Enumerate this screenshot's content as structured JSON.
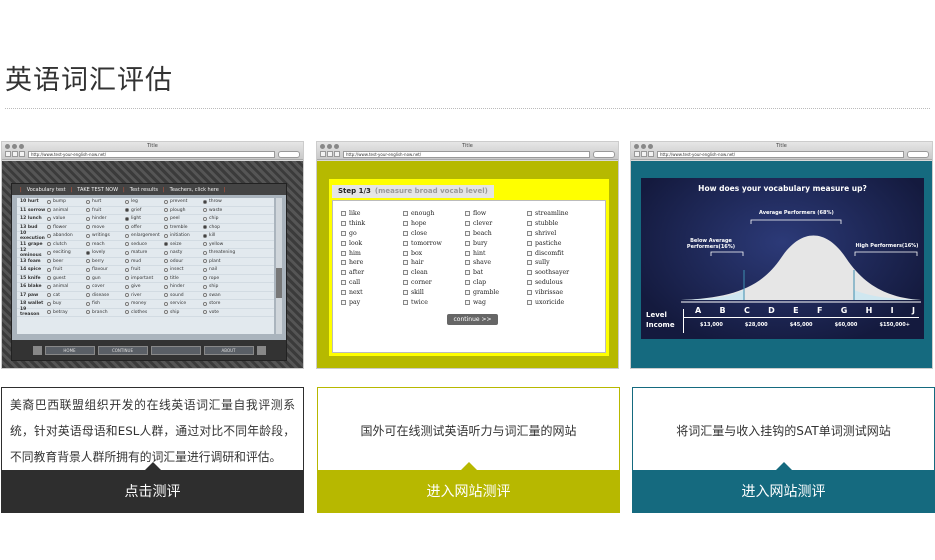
{
  "page": {
    "title": "英语词汇评估"
  },
  "browser": {
    "window_title": "Title",
    "url": "http://www.test-your-english-now.net/"
  },
  "cards": [
    {
      "tabs": [
        "Vocabulary test",
        "TAKE TEST NOW",
        "Test results",
        "Teachers, click here"
      ],
      "rows": [
        {
          "word": "10 hurt",
          "opts": [
            "bump",
            "hurt",
            "leg",
            "prevent",
            "throw"
          ],
          "sel": 4
        },
        {
          "word": "11 sorrow",
          "opts": [
            "animal",
            "fruit",
            "grief",
            "plough",
            "waste"
          ],
          "sel": 2
        },
        {
          "word": "12 lunch",
          "opts": [
            "value",
            "hinder",
            "light",
            "peel",
            "chip"
          ],
          "sel": 2
        },
        {
          "word": "13 bud",
          "opts": [
            "flower",
            "move",
            "offer",
            "tremble",
            "chop"
          ],
          "sel": 4
        },
        {
          "word": "10 execution",
          "opts": [
            "abandon",
            "writings",
            "enlargement",
            "initiation",
            "kill"
          ],
          "sel": 4
        },
        {
          "word": "11 grape",
          "opts": [
            "clutch",
            "reach",
            "seduce",
            "seize",
            "yellow"
          ],
          "sel": 3
        },
        {
          "word": "12 ominous",
          "opts": [
            "exciting",
            "lovely",
            "mature",
            "nasty",
            "threatening"
          ],
          "sel": 1
        },
        {
          "word": "13 foam",
          "opts": [
            "beer",
            "berry",
            "mud",
            "odour",
            "plant"
          ],
          "sel": -1
        },
        {
          "word": "14 spice",
          "opts": [
            "fruit",
            "flavour",
            "fruit",
            "insect",
            "nail"
          ],
          "sel": -1
        },
        {
          "word": "15 knife",
          "opts": [
            "guest",
            "gun",
            "important",
            "title",
            "rope"
          ],
          "sel": -1
        },
        {
          "word": "16 blake",
          "opts": [
            "animal",
            "cover",
            "give",
            "hinder",
            "ship"
          ],
          "sel": -1
        },
        {
          "word": "17 paw",
          "opts": [
            "cat",
            "disease",
            "river",
            "sound",
            "swan"
          ],
          "sel": -1
        },
        {
          "word": "18 wallet",
          "opts": [
            "buy",
            "fish",
            "money",
            "service",
            "store"
          ],
          "sel": -1
        },
        {
          "word": "19 treason",
          "opts": [
            "betray",
            "branch",
            "clothes",
            "ship",
            "vote"
          ],
          "sel": -1
        }
      ],
      "footer": [
        "HOME",
        "CONTINUE",
        "",
        "ABOUT"
      ]
    },
    {
      "step": "Step 1/3",
      "step_hint": "(measure broad vocab level)",
      "columns": [
        [
          "like",
          "think",
          "go",
          "look",
          "him",
          "here",
          "after",
          "call",
          "next",
          "pay"
        ],
        [
          "enough",
          "hope",
          "close",
          "tomorrow",
          "box",
          "hair",
          "clean",
          "corner",
          "skill",
          "twice"
        ],
        [
          "flow",
          "clever",
          "beach",
          "bury",
          "hint",
          "shave",
          "bat",
          "clap",
          "gramble",
          "wag"
        ],
        [
          "streamline",
          "stubble",
          "shrivel",
          "pastiche",
          "discomfit",
          "sully",
          "soothsayer",
          "sedulous",
          "vibrissae",
          "uxoricide"
        ]
      ],
      "button": "continue >>"
    },
    {
      "title": "How does your vocabulary measure up?",
      "avg": "Average Performers (68%)",
      "below": "Below Average Performers(16%)",
      "high": "High Performers(16%)",
      "level_label": "Level",
      "income_label": "Income",
      "levels": [
        "A",
        "B",
        "C",
        "D",
        "E",
        "F",
        "G",
        "H",
        "I",
        "J"
      ],
      "incomes": [
        "$13,000",
        "$28,000",
        "$45,000",
        "$60,000",
        "$150,000+"
      ]
    }
  ],
  "descriptions": [
    {
      "text": "美裔巴西联盟组织开发的在线英语词汇量自我评测系统，针对英语母语和ESL人群，通过对比不同年龄段，不同教育背景人群所拥有的词汇量进行调研和评估。",
      "button": "点击测评"
    },
    {
      "text": "国外可在线测试英语听力与词汇量的网站",
      "button": "进入网站测评"
    },
    {
      "text": "将词汇量与收入挂钩的SAT单词测试网站",
      "button": "进入网站测评"
    }
  ],
  "colors": {
    "dark": "#2e2e2e",
    "olive": "#b7b800",
    "teal": "#156a7f"
  }
}
